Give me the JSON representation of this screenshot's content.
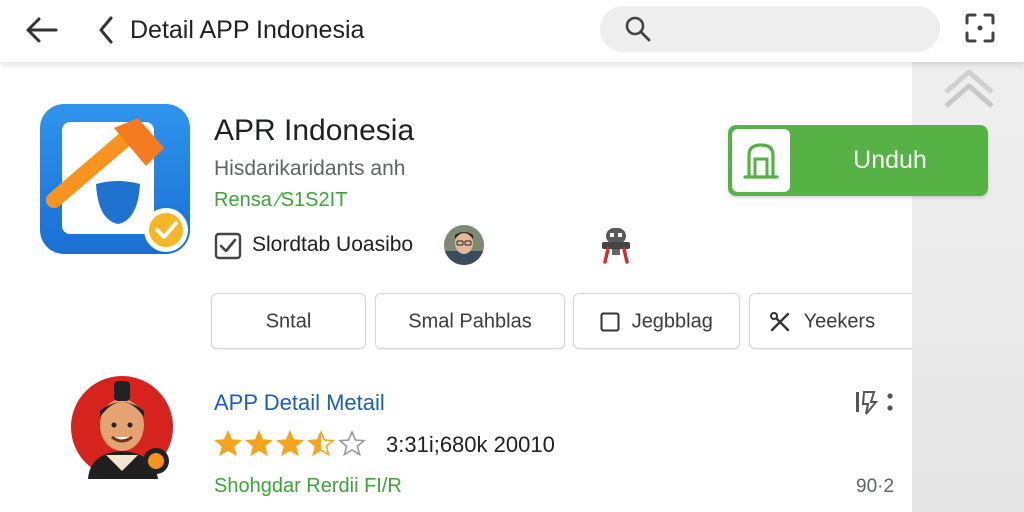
{
  "header": {
    "title": "Detail APP Indonesia",
    "search_placeholder": ""
  },
  "app": {
    "name": "APR Indonesia",
    "subtitle": "Hisdarikaridants anh",
    "rank": "Rensa ⁄S1S2IT",
    "verified_label": "Slordtab Uoasibo",
    "download_label": "Unduh"
  },
  "chips": [
    {
      "label": "Sntal"
    },
    {
      "label": "Smal Pahblas"
    },
    {
      "label": "Jegbblag"
    },
    {
      "label": "Yeekers"
    }
  ],
  "list_item": {
    "title": "APP Detail Metail",
    "rating_stars": 3.5,
    "rating_meta": "3:31i;680k 20010",
    "developer": "Shohgdar Rerdii FI/R",
    "size": "90·2"
  },
  "colors": {
    "accent_green": "#56b245",
    "link_blue": "#1a5fb4",
    "star_orange": "#f4a41e"
  },
  "icons": [
    "back-arrow-icon",
    "chevron-left-icon",
    "search-icon",
    "scan-icon",
    "scroll-up-icon",
    "checkbox-icon",
    "robot-icon",
    "download-icon",
    "star-icon",
    "more-icon"
  ]
}
